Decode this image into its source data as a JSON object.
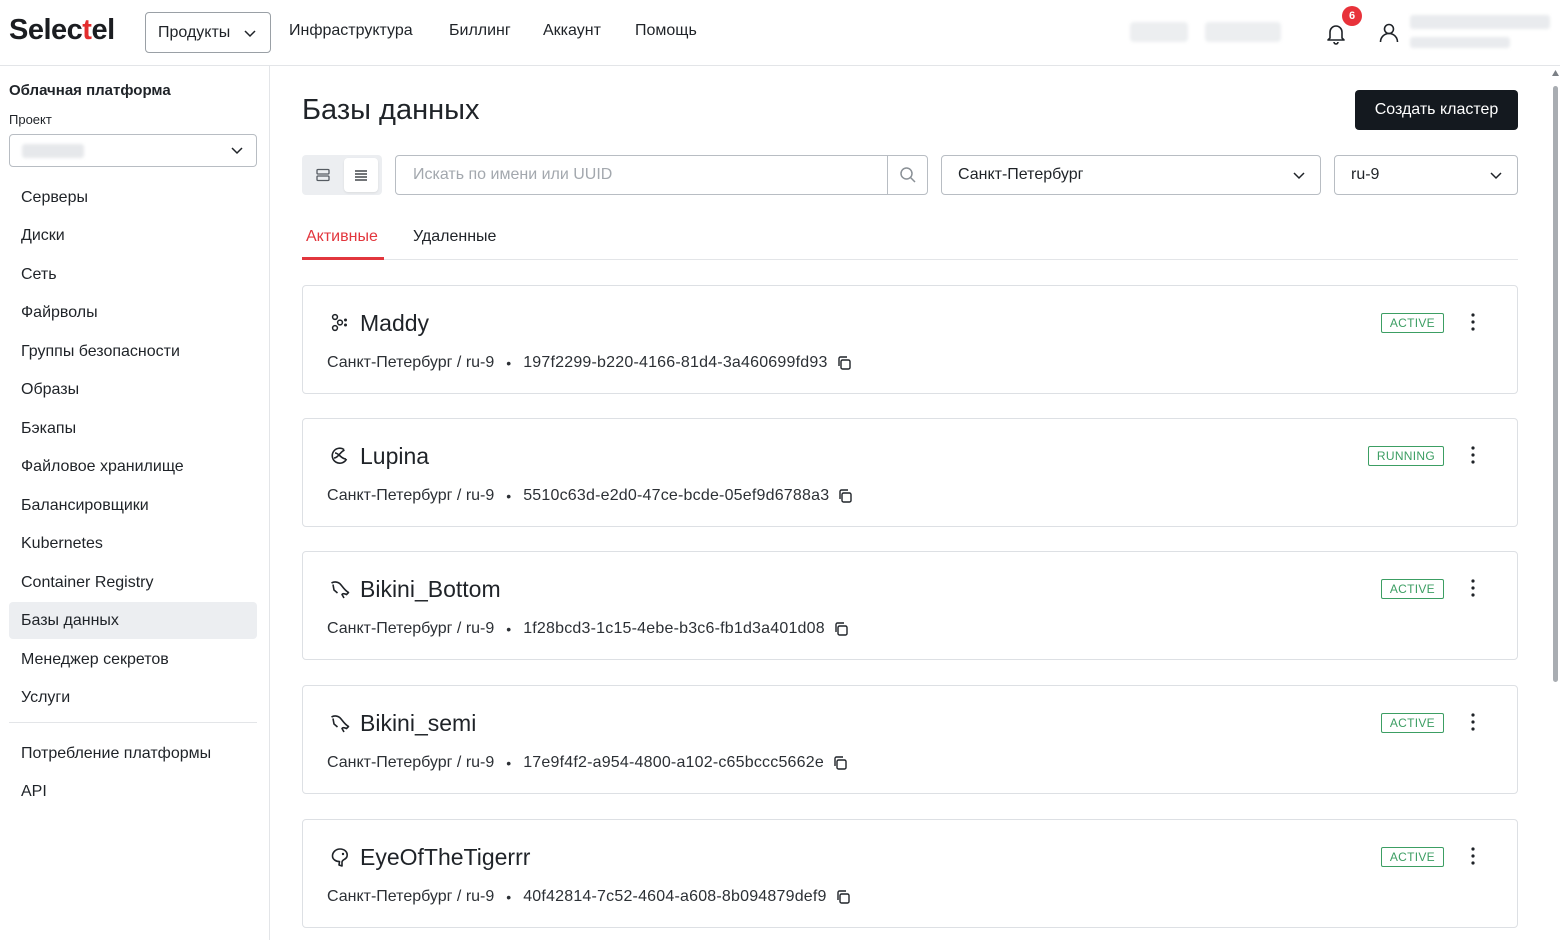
{
  "header": {
    "logo": "Selectel",
    "logo_prefix": "Selec",
    "logo_accent": "t",
    "logo_suffix": "el",
    "products_label": "Продукты",
    "nav": [
      "Инфраструктура",
      "Биллинг",
      "Аккаунт",
      "Помощь"
    ],
    "notifications_count": "6"
  },
  "sidebar": {
    "title": "Облачная платформа",
    "project_label": "Проект",
    "items": [
      "Серверы",
      "Диски",
      "Сеть",
      "Файрволы",
      "Группы безопасности",
      "Образы",
      "Бэкапы",
      "Файловое хранилище",
      "Балансировщики",
      "Kubernetes",
      "Container Registry",
      "Базы данных",
      "Менеджер секретов",
      "Услуги"
    ],
    "active_item": "Базы данных",
    "bottom_items": [
      "Потребление платформы",
      "API"
    ]
  },
  "main": {
    "title": "Базы данных",
    "create_label": "Создать кластер",
    "search_placeholder": "Искать по имени или UUID",
    "region": "Санкт-Петербург",
    "pool": "ru-9",
    "tabs": [
      "Активные",
      "Удаленные"
    ],
    "active_tab": "Активные",
    "clusters": [
      {
        "name": "Maddy",
        "location": "Санкт-Петербург / ru-9",
        "uuid": "197f2299-b220-4166-81d4-3a460699fd93",
        "status": "ACTIVE",
        "icon": "redis-icon"
      },
      {
        "name": "Lupina",
        "location": "Санкт-Петербург / ru-9",
        "uuid": "5510c63d-e2d0-47ce-bcde-05ef9d6788a3",
        "status": "RUNNING",
        "icon": "kafka-icon"
      },
      {
        "name": "Bikini_Bottom",
        "location": "Санкт-Петербург / ru-9",
        "uuid": "1f28bcd3-1c15-4ebe-b3c6-fb1d3a401d08",
        "status": "ACTIVE",
        "icon": "mysql-icon"
      },
      {
        "name": "Bikini_semi",
        "location": "Санкт-Петербург / ru-9",
        "uuid": "17e9f4f2-a954-4800-a102-c65bccc5662e",
        "status": "ACTIVE",
        "icon": "mysql-icon"
      },
      {
        "name": "EyeOfTheTigerrr",
        "location": "Санкт-Петербург / ru-9",
        "uuid": "40f42814-7c52-4604-a608-8b094879def9",
        "status": "ACTIVE",
        "icon": "postgresql-icon"
      }
    ]
  },
  "colors": {
    "accent_red": "#e2363d",
    "status_green": "#3c9e63",
    "primary_button": "#14191f"
  }
}
